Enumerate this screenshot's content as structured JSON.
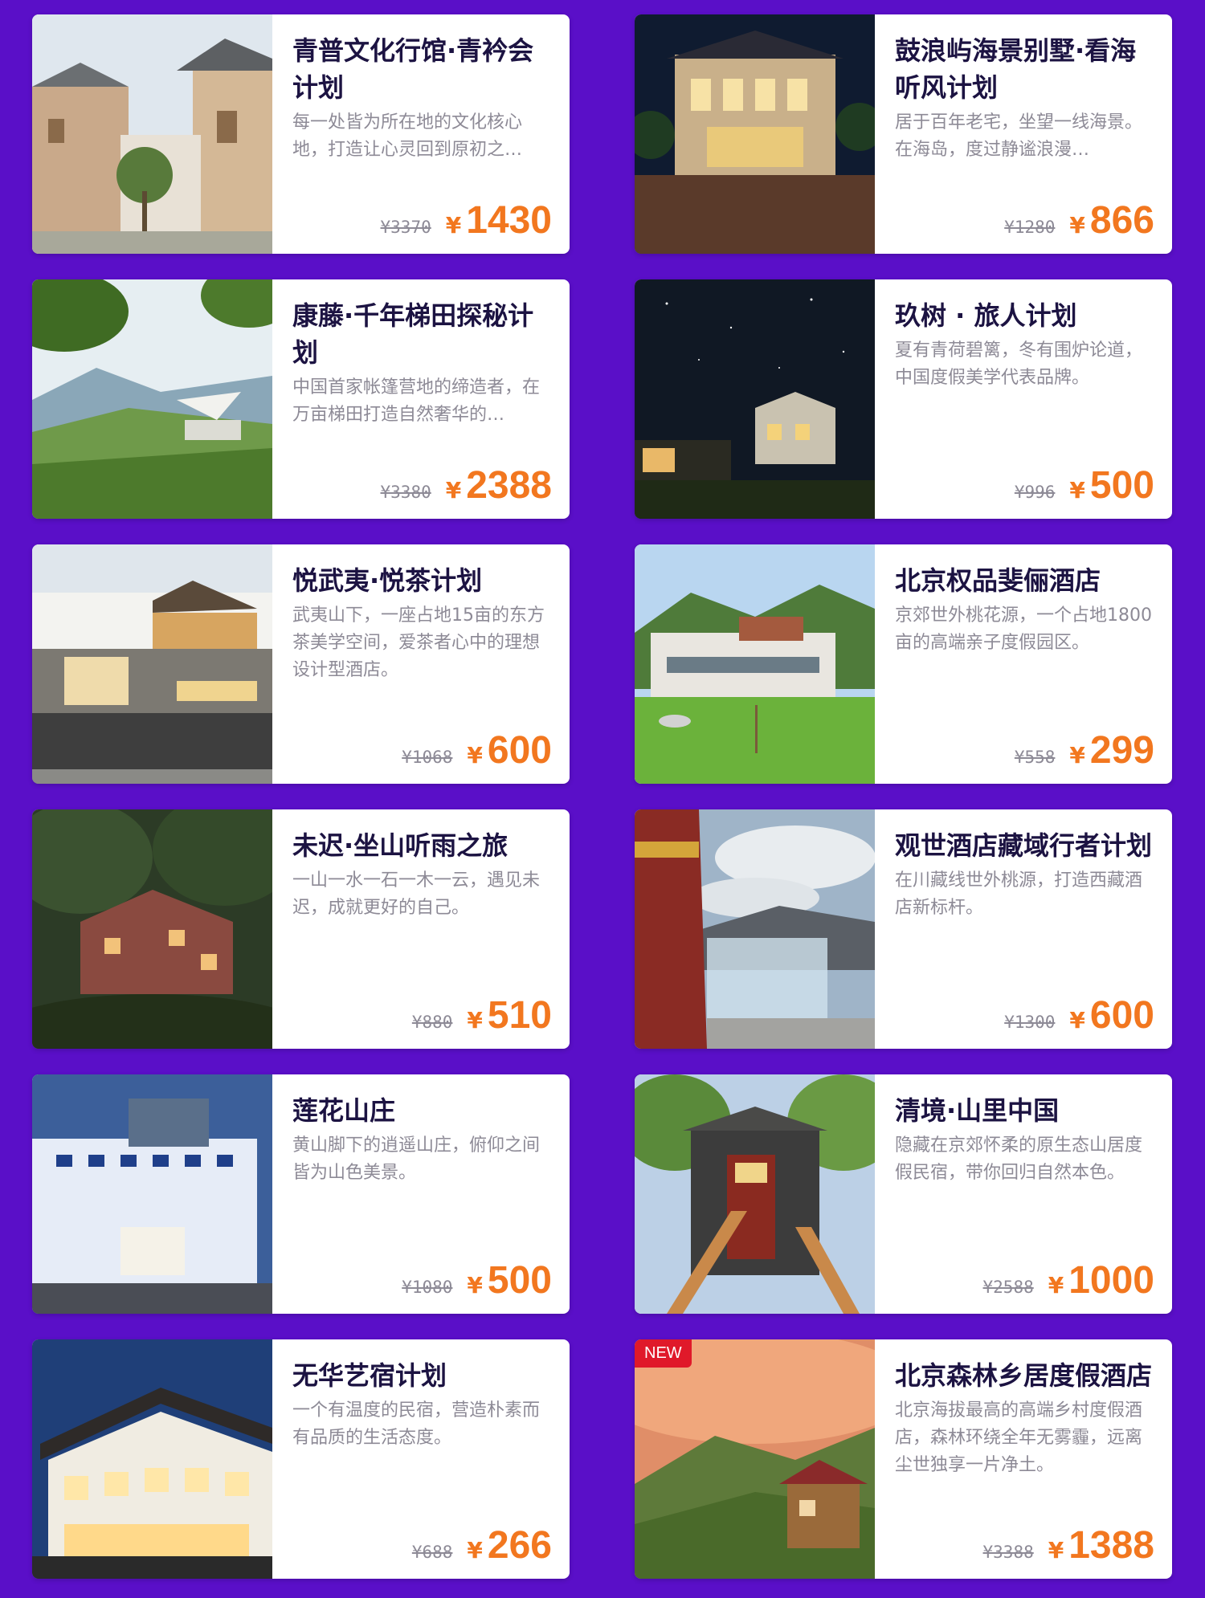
{
  "colors": {
    "background": "#5a0fc8",
    "price": "#f2771f",
    "title": "#1c1342",
    "badge": "#e0192a"
  },
  "cards": [
    {
      "title": "青普文化行馆·青衿会计划",
      "desc": "每一处皆为所在地的文化核心地，打造让心灵回到原初之…",
      "old_price": "¥3370",
      "currency": "¥",
      "price": "1430",
      "image": "courtyard-architecture-photo"
    },
    {
      "title": "鼓浪屿海景别墅·看海听风计划",
      "desc": "居于百年老宅，坐望一线海景。在海岛，度过静谧浪漫…",
      "old_price": "¥1280",
      "currency": "¥",
      "price": "866",
      "image": "villa-night-photo"
    },
    {
      "title": "康藤·千年梯田探秘计划",
      "desc": "中国首家帐篷营地的缔造者，在万亩梯田打造自然奢华的…",
      "old_price": "¥3380",
      "currency": "¥",
      "price": "2388",
      "image": "terrace-tent-photo"
    },
    {
      "title": "玖树 · 旅人计划",
      "desc": "夏有青荷碧篱，冬有围炉论道，中国度假美学代表品牌。",
      "old_price": "¥996",
      "currency": "¥",
      "price": "500",
      "image": "starry-night-lodge-photo"
    },
    {
      "title": "悦武夷·悦茶计划",
      "desc": "武夷山下，一座占地15亩的东方茶美学空间，爱茶者心中的理想设计型酒店。",
      "old_price": "¥1068",
      "currency": "¥",
      "price": "600",
      "image": "tea-hotel-facade-photo"
    },
    {
      "title": "北京权品斐俪酒店",
      "desc": "京郊世外桃花源，一个占地1800亩的高端亲子度假园区。",
      "old_price": "¥558",
      "currency": "¥",
      "price": "299",
      "image": "mountain-resort-lawn-photo"
    },
    {
      "title": "未迟·坐山听雨之旅",
      "desc": "一山一水一石一木一云，遇见未迟，成就更好的自己。",
      "old_price": "¥880",
      "currency": "¥",
      "price": "510",
      "image": "forest-brick-house-photo"
    },
    {
      "title": "观世酒店藏域行者计划",
      "desc": "在川藏线世外桃源，打造西藏酒店新标杆。",
      "old_price": "¥1300",
      "currency": "¥",
      "price": "600",
      "image": "tibetan-glass-room-photo"
    },
    {
      "title": "莲花山庄",
      "desc": "黄山脚下的逍遥山庄，俯仰之间皆为山色美景。",
      "old_price": "¥1080",
      "currency": "¥",
      "price": "500",
      "image": "lotus-villa-dusk-photo"
    },
    {
      "title": "清境·山里中国",
      "desc": "隐藏在京郊怀柔的原生态山居度假民宿，带你回归自然本色。",
      "old_price": "¥2588",
      "currency": "¥",
      "price": "1000",
      "image": "chinese-gate-stairs-photo"
    },
    {
      "title": "无华艺宿计划",
      "desc": "一个有温度的民宿，营造朴素而有品质的生活态度。",
      "old_price": "¥688",
      "currency": "¥",
      "price": "266",
      "image": "lit-wooden-inn-photo"
    },
    {
      "title": "北京森林乡居度假酒店",
      "desc": "北京海拔最高的高端乡村度假酒店，森林环绕全年无雾霾，远离尘世独享一片净土。",
      "old_price": "¥3388",
      "currency": "¥",
      "price": "1388",
      "image": "sunset-forest-cabin-photo",
      "badge": "NEW"
    }
  ]
}
